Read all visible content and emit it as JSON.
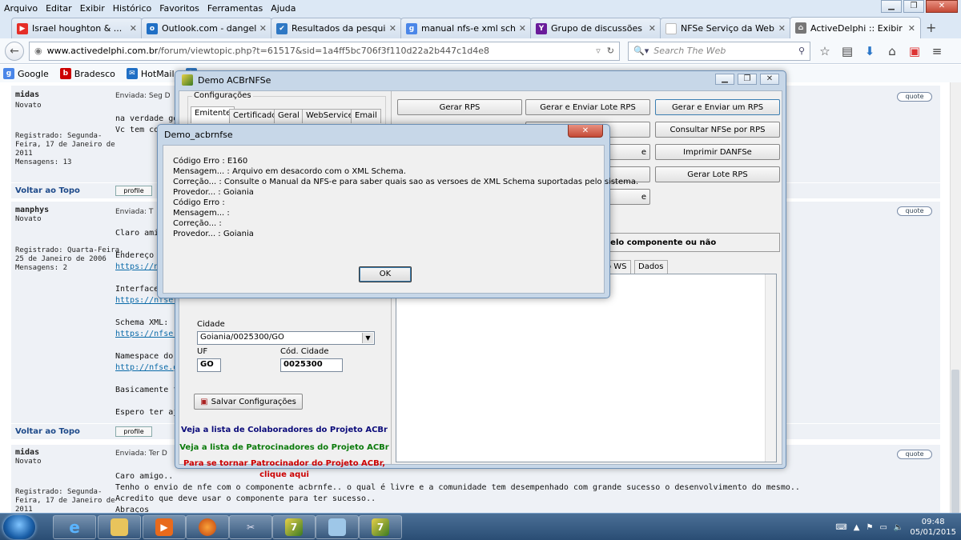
{
  "menubar": [
    "Arquivo",
    "Editar",
    "Exibir",
    "Histórico",
    "Favoritos",
    "Ferramentas",
    "Ajuda"
  ],
  "tabs": [
    {
      "label": "Israel houghton & ...",
      "icon": "youtube-icon",
      "color": "#e52d27",
      "glyph": "▶"
    },
    {
      "label": "Outlook.com - dangel...",
      "icon": "outlook-icon",
      "color": "#1f6fc5",
      "glyph": "o"
    },
    {
      "label": "Resultados da pesquis...",
      "icon": "search-results-icon",
      "color": "#2f78c4",
      "glyph": "✔"
    },
    {
      "label": "manual nfs-e xml sch...",
      "icon": "google-icon",
      "color": "#4a86e8",
      "glyph": "g"
    },
    {
      "label": "Grupo de discussões d...",
      "icon": "yahoo-icon",
      "color": "#6a1b9a",
      "glyph": "Y"
    },
    {
      "label": "NFSe Serviço da Web",
      "icon": "page-icon",
      "color": "#ffffff",
      "glyph": ""
    },
    {
      "label": "ActiveDelphi :: Exibir t...",
      "icon": "activedelphi-icon",
      "color": "#777777",
      "glyph": "⌂"
    }
  ],
  "url": {
    "host": "www.activedelphi.com.br",
    "path": "/forum/viewtopic.php?t=61517&sid=1a4ff5bc706f3f110d22a2b447c1d4e8"
  },
  "search_placeholder": "Search The Web",
  "bookmarks": [
    {
      "label": "Google",
      "color": "#4a86e8",
      "glyph": "g"
    },
    {
      "label": "Bradesco",
      "color": "#cc0000",
      "glyph": "b"
    },
    {
      "label": "HotMail",
      "color": "#1f6fc5",
      "glyph": "✉"
    },
    {
      "label": "Te",
      "color": "#2f78c4",
      "glyph": "t"
    }
  ],
  "posts": [
    {
      "name": "midas",
      "rank": "Novato",
      "info1": "Registrado: Segunda-",
      "info2": "Feira, 17 de Janeiro de",
      "info3": "2011",
      "info4": "Mensagens: 13",
      "sent": "Enviada: Seg D",
      "l1": "na verdade gos",
      "l2": "Vc tem con"
    },
    {
      "name": "manphys",
      "rank": "Novato",
      "info1": "Registrado: Quarta-Feira,",
      "info2": "25 de Janeiro de 2006",
      "info3": "Mensagens: 2",
      "sent": "Enviada: T",
      "lines": [
        "Claro amig",
        "Endereço d",
        "https://nfse",
        "Interfaces d",
        "https://nfse.go",
        "Schema XML:",
        "https://nfse.goia",
        "Namespace do",
        "http://nfse.goia",
        "Basicamente fo",
        "Espero ter ajud"
      ]
    },
    {
      "name": "midas",
      "rank": "Novato",
      "info1": "Registrado: Segunda-",
      "info2": "Feira, 17 de Janeiro de",
      "info3": "2011",
      "sent": "Enviada: Ter D",
      "lines": [
        "Caro amigo..",
        "Tenho o envio de nfe com o componente acbrnfe.. o qual é livre e a comunidade tem desempenhado com grande sucesso o desenvolvimento do mesmo..",
        "Acredito que deve usar o componente para ter sucesso..",
        "Abraços"
      ]
    }
  ],
  "forum": {
    "back": "Voltar ao Topo",
    "profile": "profile",
    "quote": "quote"
  },
  "demo": {
    "title": "Demo ACBrNFSe",
    "cfg_label": "Configurações",
    "cfg_tabs": [
      "Emitente",
      "Certificado",
      "Geral",
      "WebService",
      "Email"
    ],
    "cidade_label": "Cidade",
    "cidade_value": "Goiania/0025300/GO",
    "uf_label": "UF",
    "uf_value": "GO",
    "cod_label": "Cód. Cidade",
    "cod_value": "0025300",
    "salvar": "Salvar Configurações",
    "link1": "Veja a lista de Colaboradores do Projeto ACBr",
    "link2": "Veja a lista de Patrocinadores do Projeto ACBr",
    "link3a": "Para se tornar Patrocinador do Projeto ACBr,",
    "link3b": "clique aqui",
    "buttons": [
      "Gerar RPS",
      "Gerar e Enviar Lote RPS",
      "Gerar e Enviar um RPS",
      "Consultar NFSe por RPS",
      "Imprimir DANFSe",
      "Gerar Lote RPS"
    ],
    "partial_btn": "e",
    "bigbar": "pelo componente ou não",
    "rtabs": [
      "o WS",
      "Dados"
    ]
  },
  "dialog": {
    "title": "Demo_acbrnfse",
    "lines": [
      "Código Erro : E160",
      "Mensagem... : Arquivo em desacordo com o XML Schema.",
      "Correção... : Consulte o Manual da NFS-e para saber quais sao as versoes de XML Schema suportadas pelo sistema.",
      "Provedor... : Goiania",
      "Código Erro :",
      "Mensagem... :",
      "Correção... :",
      "Provedor... : Goiania"
    ],
    "ok": "OK"
  },
  "taskbar": {
    "time": "09:48",
    "date": "05/01/2015"
  }
}
